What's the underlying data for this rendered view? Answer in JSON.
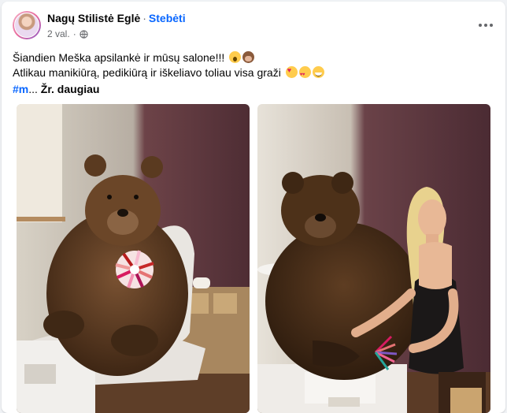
{
  "post": {
    "author": "Nagų Stilistė Eglė",
    "separator": "·",
    "follow_label": "Stebėti",
    "time": "2 val.",
    "time_separator": "·",
    "privacy_icon": "globe-icon",
    "more_icon": "more-horizontal-icon",
    "text_line1": "Šiandien Meška apsilankė ir mūsų salone!!!",
    "text_line1_emojis": [
      "face-with-open-mouth",
      "see-no-evil-monkey"
    ],
    "text_line2": "Atlikau manikiūrą, pedikiūrą ir iškeliavo toliau visa graži",
    "text_line2_emojis": [
      "smiling-face-with-hearts",
      "heart-eyes",
      "grinning-sweat"
    ],
    "hashtag": "#m",
    "ellipsis": "...",
    "see_more": "Žr. daugiau"
  },
  "colors": {
    "link": "#0866ff",
    "secondary_text": "#65676b",
    "card_bg": "#ffffff",
    "page_bg": "#f0f2f5"
  },
  "photos": [
    {
      "subject": "bear in salon chair holding nail color fan"
    },
    {
      "subject": "blonde nail stylist doing bear's manicure"
    }
  ]
}
